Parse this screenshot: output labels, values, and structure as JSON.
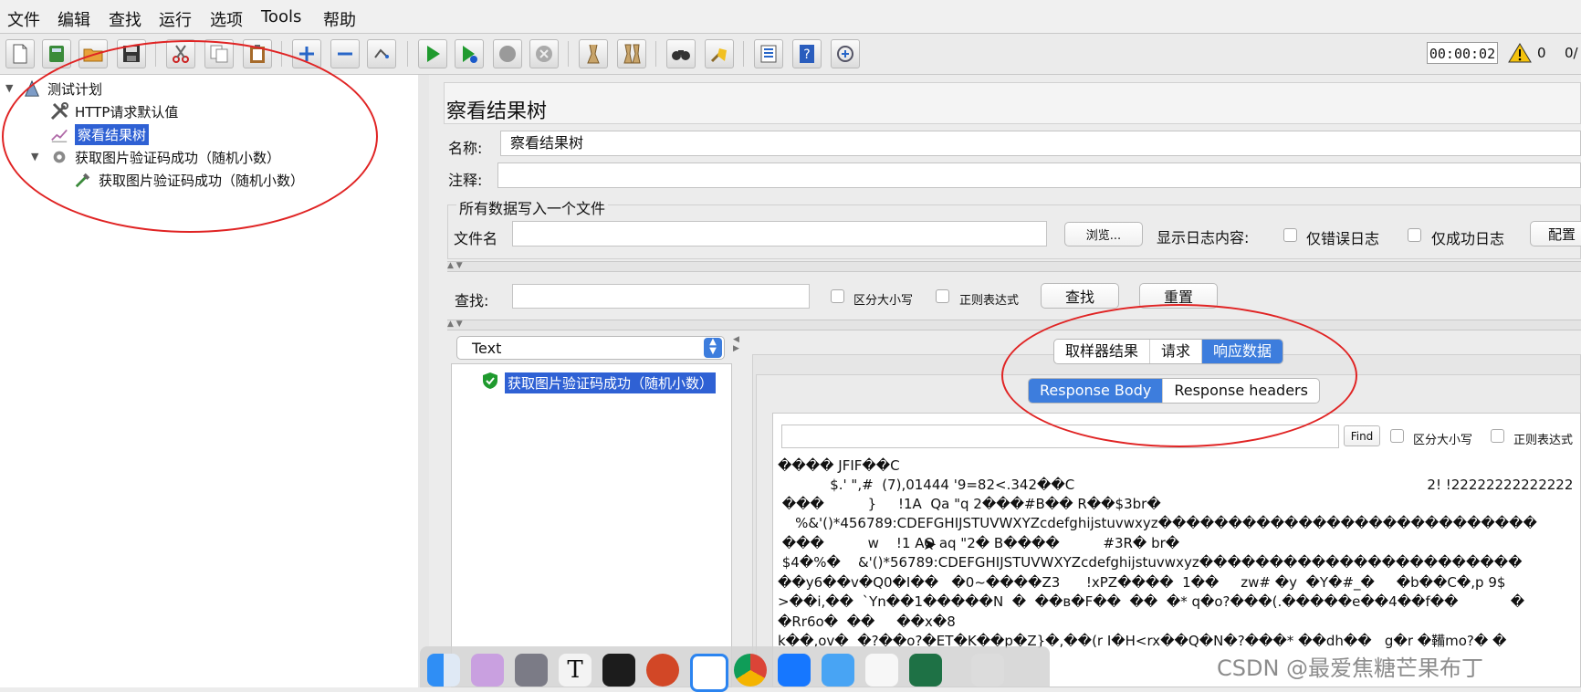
{
  "menu": [
    "文件",
    "编辑",
    "查找",
    "运行",
    "选项",
    "Tools",
    "帮助"
  ],
  "toolbar": {
    "icons": [
      "new-icon",
      "templates-icon",
      "open-icon",
      "save-icon",
      "cut-icon",
      "copy-icon",
      "paste-icon",
      "expand-icon",
      "collapse-icon",
      "toggle-icon",
      "start-icon",
      "start-no-pause-icon",
      "stop-icon",
      "shutdown-icon",
      "clear-icon",
      "clear-all-icon",
      "search-icon",
      "reset-search-icon",
      "function-helper-icon",
      "help-icon",
      "remote-icon"
    ],
    "timer": "00:00:02",
    "warning_count": "0",
    "threads": "0/"
  },
  "tree": {
    "items": [
      {
        "label": "测试计划",
        "icon": "test-plan-icon"
      },
      {
        "label": "HTTP请求默认值",
        "icon": "config-wrench-icon"
      },
      {
        "label": "察看结果树",
        "icon": "listener-chart-icon",
        "selected": true
      },
      {
        "label": "获取图片验证码成功（随机小数）",
        "icon": "thread-group-gear-icon"
      },
      {
        "label": "获取图片验证码成功（随机小数）",
        "icon": "sampler-pipette-icon"
      }
    ]
  },
  "panel": {
    "title": "察看结果树",
    "name_label": "名称:",
    "name_value": "察看结果树",
    "comment_label": "注释:",
    "comment_value": "",
    "file_section": "所有数据写入一个文件",
    "filename_label": "文件名",
    "filename_value": "",
    "browse": "浏览...",
    "log_label": "显示日志内容:",
    "errors_only": "仅错误日志",
    "success_only": "仅成功日志",
    "configure": "配置"
  },
  "search": {
    "label": "查找:",
    "value": "",
    "case": "区分大小写",
    "regex": "正则表达式",
    "find": "查找",
    "reset": "重置"
  },
  "renderer": {
    "selected": "Text"
  },
  "results": [
    {
      "label": "获取图片验证码成功（随机小数）",
      "status": "success"
    }
  ],
  "tabs": [
    "取样器结果",
    "请求",
    "响应数据"
  ],
  "active_tab": "响应数据",
  "subtabs": [
    "Response Body",
    "Response headers"
  ],
  "active_subtab": "Response Body",
  "body_search": {
    "value": "",
    "find": "Find",
    "case": "区分大小写",
    "regex": "正则表达式"
  },
  "response_body": [
    "���� JFIF��C",
    "            $.' \",#  (7),01444 '9=82<.342��C                                                                                 2! !22222222222222",
    " ���          }     !1A  Qa \"q 2���#B�� R��$3br�",
    "    %&'()*456789:CDEFGHIJSTUVWXYZcdefghijstuvwxyz���������������������������",
    " ���          w    !1 AQ aq \"2� B����          #3R� br�",
    " $4�%�    &'()*56789:CDEFGHIJSTUVWXYZcdefghijstuvwxyz�����������������������",
    "��y6��v�Q0�I��   �0~����Z3      !xPZ����  1��     zw# �y  �Y�#_�     �b��C�,p 9$",
    ">��i,��  `Yn��1�����N  �  ��в�F��  ��  �* q�o?���(.�����e��4��f��            �",
    "�Rr6o�  ��     ��x�8",
    "k��,ov�  �?��o?�ET�K��p�Z}�,��(r I�H<rx��Q�N�?���* ��dh��   g�r �鞴mo?� �"
  ],
  "watermark": "CSDN @最爱焦糖芒果布丁"
}
